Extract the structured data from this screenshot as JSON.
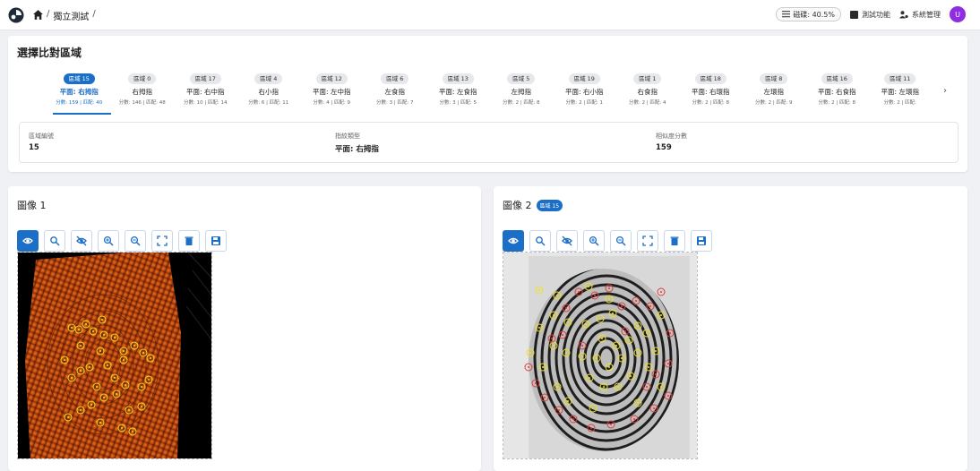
{
  "topbar": {
    "breadcrumbs": [
      "獨立測試"
    ],
    "progress_label": "磁碟: 40.5%",
    "menu": [
      "測試功能",
      "系統管理"
    ],
    "avatar_initial": "U",
    "brand_color": "#1c6fc7",
    "avatar_color": "#8e2de2"
  },
  "region_panel": {
    "title": "選擇比對區域",
    "tabs": [
      {
        "badge": "區域 15",
        "name": "平面: 右拇指",
        "sub": "分數: 159 | 匹配: 40",
        "active": true
      },
      {
        "badge": "區域 0",
        "name": "右拇指",
        "sub": "分數: 146 | 匹配: 48"
      },
      {
        "badge": "區域 17",
        "name": "平面: 右中指",
        "sub": "分數: 10 | 匹配: 14"
      },
      {
        "badge": "區域 4",
        "name": "右小指",
        "sub": "分數: 6 | 匹配: 11"
      },
      {
        "badge": "區域 12",
        "name": "平面: 左中指",
        "sub": "分數: 4 | 匹配: 9"
      },
      {
        "badge": "區域 6",
        "name": "左食指",
        "sub": "分數: 3 | 匹配: 7"
      },
      {
        "badge": "區域 13",
        "name": "平面: 左食指",
        "sub": "分數: 3 | 匹配: 5"
      },
      {
        "badge": "區域 5",
        "name": "左拇指",
        "sub": "分數: 2 | 匹配: 8"
      },
      {
        "badge": "區域 19",
        "name": "平面: 右小指",
        "sub": "分數: 2 | 匹配: 1"
      },
      {
        "badge": "區域 1",
        "name": "右食指",
        "sub": "分數: 2 | 匹配: 4"
      },
      {
        "badge": "區域 18",
        "name": "平面: 右環指",
        "sub": "分數: 2 | 匹配: 8"
      },
      {
        "badge": "區域 8",
        "name": "左環指",
        "sub": "分數: 2 | 匹配: 9"
      },
      {
        "badge": "區域 16",
        "name": "平面: 右食指",
        "sub": "分數: 2 | 匹配: 8"
      },
      {
        "badge": "區域 11",
        "name": "平面: 左環指",
        "sub": "分數: 2 | 匹配:"
      }
    ],
    "info": {
      "region_id_label": "區域編號",
      "region_id_value": "15",
      "type_label": "指紋類型",
      "type_value": "平面: 右拇指",
      "score_label": "相似度分數",
      "score_value": "159"
    }
  },
  "image1": {
    "title": "圖像 1"
  },
  "image2": {
    "title": "圖像 2",
    "badge": "區域 15"
  },
  "toolbar_icons": [
    "eye-icon",
    "zoom-fit-icon",
    "eye-off-icon",
    "zoom-in-icon",
    "zoom-out-icon",
    "fullscreen-icon",
    "trash-icon",
    "save-icon"
  ],
  "marker_colors": {
    "match": "#f0e21a",
    "non_match": "#e23b3b"
  }
}
